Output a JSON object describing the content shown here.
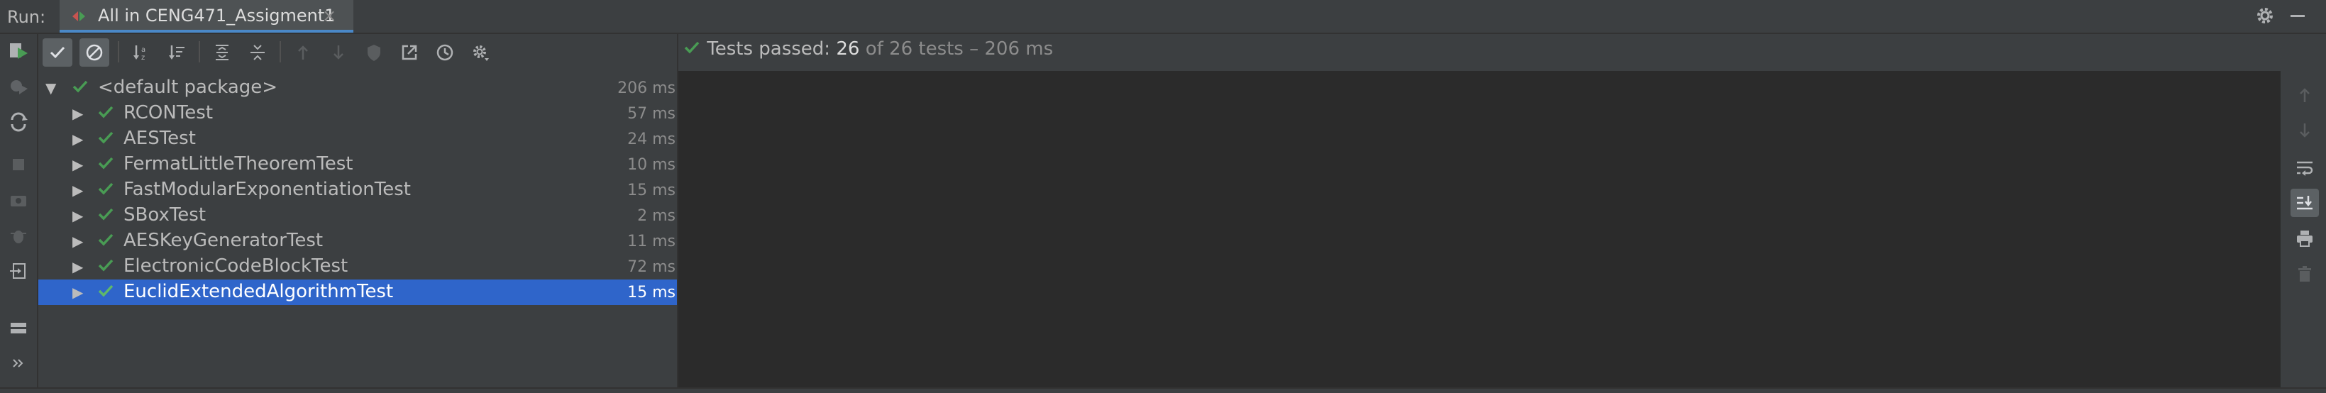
{
  "header": {
    "run_label": "Run:",
    "tab_title": "All in CENG471_Assigment1",
    "tab_close": "×"
  },
  "status": {
    "prefix": "Tests passed: ",
    "passed": "26",
    "of_text": " of ",
    "total": "26 tests",
    "duration": " – 206 ms"
  },
  "tree": {
    "rows": [
      {
        "name": "<default package>",
        "time": "206 ms",
        "level": 0,
        "expanded": true,
        "selected": false
      },
      {
        "name": "RCONTest",
        "time": "57 ms",
        "level": 1,
        "expanded": false,
        "selected": false
      },
      {
        "name": "AESTest",
        "time": "24 ms",
        "level": 1,
        "expanded": false,
        "selected": false
      },
      {
        "name": "FermatLittleTheoremTest",
        "time": "10 ms",
        "level": 1,
        "expanded": false,
        "selected": false
      },
      {
        "name": "FastModularExponentiationTest",
        "time": "15 ms",
        "level": 1,
        "expanded": false,
        "selected": false
      },
      {
        "name": "SBoxTest",
        "time": "2 ms",
        "level": 1,
        "expanded": false,
        "selected": false
      },
      {
        "name": "AESKeyGeneratorTest",
        "time": "11 ms",
        "level": 1,
        "expanded": false,
        "selected": false
      },
      {
        "name": "ElectronicCodeBlockTest",
        "time": "72 ms",
        "level": 1,
        "expanded": false,
        "selected": false
      },
      {
        "name": "EuclidExtendedAlgorithmTest",
        "time": "15 ms",
        "level": 1,
        "expanded": false,
        "selected": true
      }
    ]
  },
  "colors": {
    "background": "#3c3f41",
    "console": "#2b2b2b",
    "selection": "#2f65ca",
    "pass_green": "#499c54",
    "accent_blue": "#4a88c7"
  },
  "icons": {
    "left_strip": [
      "rerun-icon",
      "rerun-failed-icon",
      "toggle-auto-test-icon",
      "stop-icon",
      "camera-icon",
      "debug-icon",
      "exit-icon",
      "layout-icon",
      "expand-more-icon"
    ],
    "toolbar": [
      "show-passed-icon",
      "show-ignored-icon",
      "sort-alpha-icon",
      "sort-duration-icon",
      "expand-all-icon",
      "collapse-all-icon",
      "previous-failed-icon",
      "next-failed-icon",
      "shield-icon",
      "export-icon",
      "history-icon",
      "settings-icon"
    ],
    "right_strip": [
      "scroll-up-icon",
      "scroll-down-icon",
      "soft-wrap-icon",
      "scroll-to-end-icon",
      "print-icon",
      "trash-icon"
    ]
  }
}
